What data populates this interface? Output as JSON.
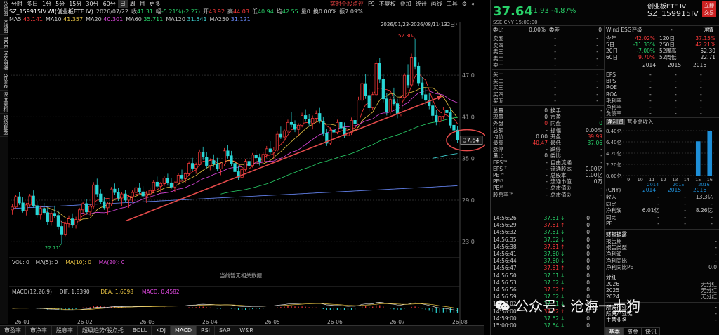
{
  "left_strip": [
    "分时图",
    "K线图",
    "TICK",
    "成交明细",
    "分价表",
    "深度资料",
    "超级复盘"
  ],
  "toolbar": {
    "periods": [
      "分时",
      "多日",
      "1分",
      "5分",
      "15分",
      "30分",
      "60分",
      "日",
      "周",
      "月",
      "更多"
    ],
    "active_period": "日",
    "right_items": [
      "实时个股点评",
      "F9",
      "不复权",
      "叠加",
      "统计",
      "画线",
      "工具"
    ],
    "gear": "齿轮",
    "collapse": "折叠"
  },
  "info": {
    "code": "SZ_159915IV.WI(创业板ETF IV)",
    "date": "2026/07/22",
    "close_label": "收",
    "close": "41.31",
    "change_label": "幅",
    "change": "-5.21%(-2.27)",
    "open_label": "开",
    "open": "43.92",
    "high_label": "高",
    "high": "44.03",
    "low_label": "低",
    "low": "40.94",
    "avg_label": "均",
    "avg": "42.55",
    "vol_label": "量",
    "vol": "0",
    "turnover_label": "换",
    "turnover": "0.00%",
    "amp_label": "振",
    "amp": "7.09%"
  },
  "ma": [
    {
      "label": "MA5",
      "value": "43.141",
      "color": "#ff3b3b"
    },
    {
      "label": "MA10",
      "value": "41.357",
      "color": "#e8c343"
    },
    {
      "label": "MA20",
      "value": "40.301",
      "color": "#e048e0"
    },
    {
      "label": "MA60",
      "value": "35.711",
      "color": "#29d36a"
    },
    {
      "label": "MA120",
      "value": "31.541",
      "color": "#3fd3d3"
    },
    {
      "label": "MA250",
      "value": "31.121",
      "color": "#6b8cff"
    }
  ],
  "chart": {
    "range_label": "2026/01/23-2026/08/11(132日)",
    "y_ticks": [
      "47.0",
      "41.0",
      "35.0",
      "29.0",
      "23.0"
    ],
    "high_mark": "52.30",
    "low_mark": "22.71",
    "last_price_tag": "37.64",
    "x_ticks": [
      "26-01",
      "26-02",
      "26-03",
      "26-04",
      "26-05",
      "26-06",
      "26-07",
      "26-08"
    ],
    "vol_label": "VOL: 0 MA(5): 0 MA(10): 0 MA(20): 0",
    "vol_parts": [
      {
        "text": "VOL: 0",
        "color": "#c8c8c8"
      },
      {
        "text": "MA(5): 0",
        "color": "#c8c8c8"
      },
      {
        "text": "MA(10): 0",
        "color": "#e8c343"
      },
      {
        "text": "MA(20): 0",
        "color": "#e048e0"
      }
    ],
    "no_data": "当前暂无相关数据",
    "macd_parts": [
      {
        "text": "MACD(12,26,9)",
        "color": "#c8c8c8"
      },
      {
        "text": "DIF: 1.8390",
        "color": "#c8c8c8"
      },
      {
        "text": "DEA: 1.6098",
        "color": "#e8c343"
      },
      {
        "text": "MACD: 0.4582",
        "color": "#e048e0"
      }
    ],
    "macd_tag": "-1.8608",
    "candles": [
      [
        27.6,
        28.4,
        26.9,
        28.0
      ],
      [
        28.0,
        29.8,
        27.8,
        29.5
      ],
      [
        29.5,
        30.2,
        28.3,
        28.6
      ],
      [
        28.6,
        29.4,
        27.2,
        27.5
      ],
      [
        27.5,
        28.6,
        26.8,
        28.3
      ],
      [
        28.3,
        29.9,
        28.0,
        29.6
      ],
      [
        29.6,
        30.4,
        27.9,
        28.2
      ],
      [
        28.2,
        28.9,
        26.5,
        26.9
      ],
      [
        26.9,
        28.1,
        26.2,
        27.8
      ],
      [
        27.8,
        28.6,
        26.9,
        27.2
      ],
      [
        27.2,
        27.9,
        25.4,
        25.9
      ],
      [
        25.9,
        27.4,
        25.3,
        27.1
      ],
      [
        27.1,
        28.2,
        26.4,
        26.8
      ],
      [
        26.8,
        27.5,
        24.8,
        25.2
      ],
      [
        25.2,
        26.1,
        22.71,
        24.1
      ],
      [
        24.1,
        25.9,
        23.8,
        25.6
      ],
      [
        25.6,
        26.8,
        25.1,
        26.3
      ],
      [
        26.3,
        27.1,
        25.0,
        25.4
      ],
      [
        25.4,
        26.6,
        24.9,
        26.2
      ],
      [
        26.2,
        27.9,
        25.9,
        27.6
      ],
      [
        27.6,
        28.8,
        27.1,
        28.5
      ],
      [
        28.5,
        29.1,
        26.9,
        27.3
      ],
      [
        27.3,
        28.4,
        26.8,
        28.1
      ],
      [
        28.1,
        31.6,
        27.8,
        31.2
      ],
      [
        31.2,
        32.1,
        29.5,
        29.9
      ],
      [
        29.9,
        30.6,
        28.4,
        28.8
      ],
      [
        28.8,
        29.5,
        27.6,
        27.9
      ],
      [
        27.9,
        28.8,
        26.9,
        28.5
      ],
      [
        28.5,
        30.9,
        28.1,
        30.6
      ],
      [
        30.6,
        31.4,
        29.8,
        30.1
      ],
      [
        30.1,
        30.8,
        28.9,
        29.3
      ],
      [
        29.3,
        30.2,
        28.1,
        29.9
      ],
      [
        29.9,
        30.5,
        28.7,
        29.0
      ],
      [
        29.0,
        29.8,
        27.9,
        29.5
      ],
      [
        29.5,
        30.4,
        28.8,
        30.1
      ],
      [
        30.1,
        31.2,
        29.6,
        30.8
      ],
      [
        30.8,
        31.5,
        29.9,
        30.2
      ],
      [
        30.2,
        31.0,
        29.1,
        29.6
      ],
      [
        29.6,
        30.3,
        28.6,
        29.9
      ],
      [
        29.9,
        30.7,
        29.2,
        30.4
      ],
      [
        30.4,
        31.9,
        30.0,
        31.6
      ],
      [
        31.6,
        32.4,
        30.7,
        31.0
      ],
      [
        31.0,
        31.6,
        30.1,
        31.4
      ],
      [
        31.4,
        32.5,
        31.0,
        32.2
      ],
      [
        32.2,
        32.8,
        31.1,
        31.5
      ],
      [
        31.5,
        32.2,
        30.6,
        30.9
      ],
      [
        30.9,
        31.7,
        30.2,
        31.5
      ],
      [
        31.5,
        32.9,
        31.2,
        32.6
      ],
      [
        32.6,
        33.4,
        31.8,
        32.1
      ],
      [
        32.1,
        33.0,
        31.5,
        32.8
      ],
      [
        32.8,
        34.6,
        32.5,
        34.3
      ],
      [
        34.3,
        35.1,
        33.2,
        33.6
      ],
      [
        33.6,
        34.4,
        32.8,
        34.1
      ],
      [
        34.1,
        36.3,
        33.9,
        35.9
      ],
      [
        35.9,
        36.7,
        34.8,
        35.2
      ],
      [
        35.2,
        35.9,
        33.6,
        34.0
      ],
      [
        34.0,
        35.0,
        33.3,
        34.7
      ],
      [
        34.7,
        35.6,
        33.8,
        34.2
      ],
      [
        34.2,
        35.1,
        33.2,
        33.5
      ],
      [
        33.5,
        34.5,
        32.6,
        34.2
      ],
      [
        34.2,
        36.5,
        33.9,
        36.1
      ],
      [
        36.1,
        37.0,
        35.0,
        35.4
      ],
      [
        35.4,
        36.1,
        33.9,
        34.3
      ],
      [
        34.3,
        35.2,
        32.8,
        33.1
      ],
      [
        33.1,
        34.0,
        31.9,
        32.3
      ],
      [
        32.3,
        33.7,
        32.0,
        33.4
      ],
      [
        33.4,
        34.9,
        33.1,
        34.6
      ],
      [
        34.6,
        35.3,
        33.6,
        34.0
      ],
      [
        34.0,
        35.8,
        33.7,
        35.5
      ],
      [
        35.5,
        36.2,
        34.6,
        35.1
      ],
      [
        35.1,
        35.7,
        34.0,
        34.5
      ],
      [
        34.5,
        35.9,
        34.2,
        35.6
      ],
      [
        35.6,
        36.8,
        35.1,
        36.4
      ],
      [
        36.4,
        37.5,
        35.6,
        35.9
      ],
      [
        35.9,
        36.6,
        34.9,
        36.2
      ],
      [
        36.2,
        38.9,
        36.0,
        38.5
      ],
      [
        38.5,
        39.6,
        37.8,
        38.1
      ],
      [
        38.1,
        39.3,
        37.6,
        39.0
      ],
      [
        39.0,
        40.6,
        38.6,
        40.2
      ],
      [
        40.2,
        41.7,
        39.5,
        39.9
      ],
      [
        39.9,
        40.5,
        38.8,
        39.2
      ],
      [
        39.2,
        40.1,
        38.3,
        39.8
      ],
      [
        39.8,
        41.6,
        39.5,
        41.2
      ],
      [
        41.2,
        42.1,
        40.3,
        40.7
      ],
      [
        40.7,
        41.4,
        39.6,
        40.1
      ],
      [
        40.1,
        41.2,
        39.2,
        40.8
      ],
      [
        40.8,
        41.9,
        40.2,
        41.5
      ],
      [
        41.5,
        42.3,
        40.1,
        40.4
      ],
      [
        40.4,
        41.0,
        38.2,
        38.6
      ],
      [
        38.6,
        39.3,
        36.8,
        37.2
      ],
      [
        37.2,
        39.5,
        36.9,
        39.1
      ],
      [
        39.1,
        40.3,
        38.4,
        38.8
      ],
      [
        38.8,
        40.6,
        38.5,
        40.2
      ],
      [
        40.2,
        41.1,
        39.0,
        39.4
      ],
      [
        39.4,
        40.2,
        37.9,
        38.3
      ],
      [
        38.3,
        39.0,
        37.1,
        38.7
      ],
      [
        38.7,
        40.9,
        38.4,
        40.5
      ],
      [
        40.5,
        41.8,
        39.7,
        40.0
      ],
      [
        40.0,
        43.9,
        39.8,
        43.4
      ],
      [
        43.4,
        46.1,
        42.9,
        45.8
      ],
      [
        45.8,
        47.2,
        43.6,
        44.1
      ],
      [
        44.1,
        45.0,
        41.8,
        42.3
      ],
      [
        42.3,
        44.6,
        42.0,
        44.2
      ],
      [
        44.2,
        49.1,
        44.0,
        48.7
      ],
      [
        48.7,
        49.5,
        45.9,
        46.4
      ],
      [
        46.4,
        47.2,
        43.1,
        43.6
      ],
      [
        43.6,
        44.4,
        41.2,
        41.7
      ],
      [
        41.7,
        43.9,
        41.3,
        43.5
      ],
      [
        43.5,
        45.2,
        42.6,
        42.9
      ],
      [
        42.9,
        43.6,
        40.8,
        41.4
      ],
      [
        41.4,
        44.1,
        41.1,
        43.8
      ],
      [
        43.8,
        47.3,
        43.5,
        47.0
      ],
      [
        47.0,
        48.6,
        45.2,
        45.6
      ],
      [
        45.6,
        50.1,
        45.3,
        49.6
      ],
      [
        49.6,
        52.3,
        47.9,
        48.3
      ],
      [
        48.3,
        48.9,
        45.4,
        45.9
      ],
      [
        45.9,
        46.8,
        43.6,
        44.2
      ],
      [
        44.2,
        45.1,
        42.8,
        43.4
      ],
      [
        43.4,
        44.5,
        42.1,
        42.6
      ],
      [
        42.6,
        43.3,
        40.5,
        41.2
      ],
      [
        41.2,
        42.0,
        39.8,
        40.3
      ],
      [
        40.3,
        41.4,
        39.5,
        41.1
      ],
      [
        41.1,
        42.4,
        40.6,
        42.0
      ],
      [
        42.0,
        43.3,
        41.2,
        41.6
      ],
      [
        41.6,
        42.2,
        39.4,
        39.8
      ],
      [
        39.8,
        40.5,
        38.6,
        39.1
      ],
      [
        39.1,
        39.7,
        37.2,
        37.64
      ]
    ]
  },
  "right": {
    "name": "创业板ETF IV",
    "code": "SZ_159915IV",
    "price": "37.64",
    "change": "-1.93",
    "pct": "-4.87%",
    "button": "立即交易",
    "sub": "SSE  CNY  15:00:00",
    "order_head": [
      {
        "label": "委比",
        "v1": "0.00%",
        "label2": "委差",
        "v2": "0"
      }
    ],
    "asks": [
      {
        "label": "卖五",
        "price": "-",
        "vol": "-"
      },
      {
        "label": "卖四",
        "price": "-",
        "vol": "-"
      },
      {
        "label": "卖三",
        "price": "-",
        "vol": "-"
      },
      {
        "label": "卖二",
        "price": "-",
        "vol": "-"
      },
      {
        "label": "卖一",
        "price": "-",
        "vol": "-"
      }
    ],
    "bids": [
      {
        "label": "买一",
        "price": "-",
        "vol": "-"
      },
      {
        "label": "买二",
        "price": "-",
        "vol": "-"
      },
      {
        "label": "买三",
        "price": "-",
        "vol": "-"
      },
      {
        "label": "买四",
        "price": "-",
        "vol": "-"
      },
      {
        "label": "买五",
        "price": "-",
        "vol": "-"
      }
    ],
    "stats": [
      {
        "l1": "总量",
        "v1": "0",
        "l2": "换手",
        "v2": "-"
      },
      {
        "l1": "现量",
        "v1": "0",
        "l2": "市盈",
        "v2": "-"
      },
      {
        "l1": "外盘",
        "v1": "0",
        "l2": "内盘",
        "v2": "0"
      },
      {
        "l1": "总额",
        "v1": "-",
        "l2": "振幅",
        "v2": "0.00%"
      },
      {
        "l1": "均价",
        "v1": "0.00",
        "l2": "开盘",
        "v2": "39.99"
      },
      {
        "l1": "最高",
        "v1": "40.47",
        "l2": "最低",
        "v2": "37.06"
      },
      {
        "l1": "涨停",
        "v1": "-",
        "l2": "跌停",
        "v2": "-"
      },
      {
        "l1": "量比",
        "v1": "0",
        "l2": "委比",
        "v2": "-"
      },
      {
        "l1": "EPS™",
        "v1": "-",
        "l2": "自由流通",
        "v2": "-"
      },
      {
        "l1": "EPSᴸᵀ",
        "v1": "-",
        "l2": "流通股本",
        "v2": "0.00亿"
      },
      {
        "l1": "PE™",
        "v1": "-",
        "l2": "总股本",
        "v2": "0.00亿"
      },
      {
        "l1": "PEᴸᵀ",
        "v1": "-",
        "l2": "流通市值",
        "v2": "0万"
      },
      {
        "l1": "PBᴸᶠ",
        "v1": "-",
        "l2": "总市值①",
        "v2": "-"
      },
      {
        "l1": "股息率™",
        "v1": "-",
        "l2": "总市值②",
        "v2": "-"
      }
    ],
    "ticks": [
      {
        "t": "14:56:26",
        "p": "37.61",
        "v": "0"
      },
      {
        "t": "14:56:29",
        "p": "37.61",
        "v": "0"
      },
      {
        "t": "14:56:32",
        "p": "37.61",
        "v": "0"
      },
      {
        "t": "14:56:35",
        "p": "37.62",
        "v": "0"
      },
      {
        "t": "14:56:38",
        "p": "37.61",
        "v": "0"
      },
      {
        "t": "14:56:41",
        "p": "37.60",
        "v": "0"
      },
      {
        "t": "14:56:44",
        "p": "37.60",
        "v": "0"
      },
      {
        "t": "14:56:47",
        "p": "37.61",
        "v": "0"
      },
      {
        "t": "14:56:50",
        "p": "37.61",
        "v": "0"
      },
      {
        "t": "14:56:53",
        "p": "37.62",
        "v": "0"
      },
      {
        "t": "14:56:56",
        "p": "37.62",
        "v": "0"
      },
      {
        "t": "14:56:59",
        "p": "37.62",
        "v": "0"
      },
      {
        "t": "14:57:02",
        "p": "37.61",
        "v": "0"
      },
      {
        "t": "14:58:00",
        "p": "37.62",
        "v": "0"
      },
      {
        "t": "14:59:00",
        "p": "37.62",
        "v": "0"
      },
      {
        "t": "15:00:00",
        "p": "37.64",
        "v": "0"
      }
    ],
    "perf_head": {
      "label": "Wind ESG评级",
      "value": "-",
      "link": "详情"
    },
    "perf": [
      {
        "l1": "今年",
        "v1": "42.02%",
        "c1": "#ff3b3b",
        "l2": "120日",
        "v2": "37.15%",
        "c2": "#ff3b3b"
      },
      {
        "l1": "5日",
        "v1": "-11.33%",
        "c1": "#29d36a",
        "l2": "250日",
        "v2": "42.21%",
        "c2": "#ff3b3b"
      },
      {
        "l1": "20日",
        "v1": "-7.00%",
        "c1": "#29d36a",
        "l2": "52周高",
        "v2": "52.30",
        "c2": "#dddddd"
      },
      {
        "l1": "60日",
        "v1": "9.70%",
        "c1": "#ff3b3b",
        "l2": "52周低",
        "v2": "22.71",
        "c2": "#dddddd"
      }
    ],
    "years": [
      "2014",
      "2015",
      "2016"
    ],
    "fund": [
      "EPS",
      "BPS",
      "ROE",
      "ROA",
      "毛利率",
      "净利率",
      "负债率"
    ],
    "netprofit_title": "净利润",
    "revenue_title": "营业总收入",
    "bar_yticks": [
      "8.40亿",
      "6.40亿",
      "4.20亿",
      "2.20亿",
      "0.00亿"
    ],
    "bar_xticks": [
      "9",
      "10",
      "11",
      "12",
      "13",
      "14",
      "15",
      "16"
    ],
    "bar_years": [
      "2014",
      "2015",
      "2016"
    ],
    "bar_values": [
      0,
      0,
      0,
      0,
      0,
      0,
      6.4,
      8.4
    ],
    "fin_unit": "(CNY)",
    "fin_cols": [
      "2014",
      "2015",
      "2016"
    ],
    "fin_rows": [
      {
        "label": "收入",
        "v": [
          "-",
          "-",
          "13.3亿"
        ]
      },
      {
        "label": "同比",
        "v": [
          "-",
          "-",
          "-"
        ]
      },
      {
        "label": "净利润",
        "v": [
          "6.01亿",
          "-",
          "8.26亿"
        ]
      },
      {
        "label": "同比",
        "v": [
          "-",
          "-",
          "-"
        ]
      },
      {
        "label": "PE",
        "v": [
          "-",
          "-",
          "-"
        ]
      }
    ],
    "report_title": "财报披露",
    "report": [
      {
        "label": "报告期",
        "v": "-"
      },
      {
        "label": "报告类型",
        "v": "-"
      },
      {
        "label": "净利润",
        "v": "-"
      },
      {
        "label": "净利同比",
        "v": "-"
      },
      {
        "label": "净利同比PE",
        "v": "0.0"
      }
    ],
    "div_title": "分红",
    "div": [
      {
        "label": "2026",
        "v": "无分红"
      },
      {
        "label": "2025",
        "v": "无分红"
      },
      {
        "label": "2024",
        "v": "无分红"
      }
    ],
    "sector": [
      {
        "label": "所属行业",
        "v": "-"
      },
      {
        "label": "所属产业链",
        "v": "-"
      },
      {
        "label": "主营业务",
        "v": "-"
      }
    ],
    "tabs": [
      "基本",
      "资金",
      "快讯"
    ],
    "active_tab": "基本"
  },
  "bottom_tabs": [
    "市盈率",
    "市净率",
    "股息率",
    "超级趋势/股点托",
    "BOLL",
    "KDJ",
    "MACD",
    "RSI",
    "SAR",
    "W&R"
  ],
  "active_bottom_tab": "MACD",
  "watermark": "公众号 · 沧海一土狗"
}
